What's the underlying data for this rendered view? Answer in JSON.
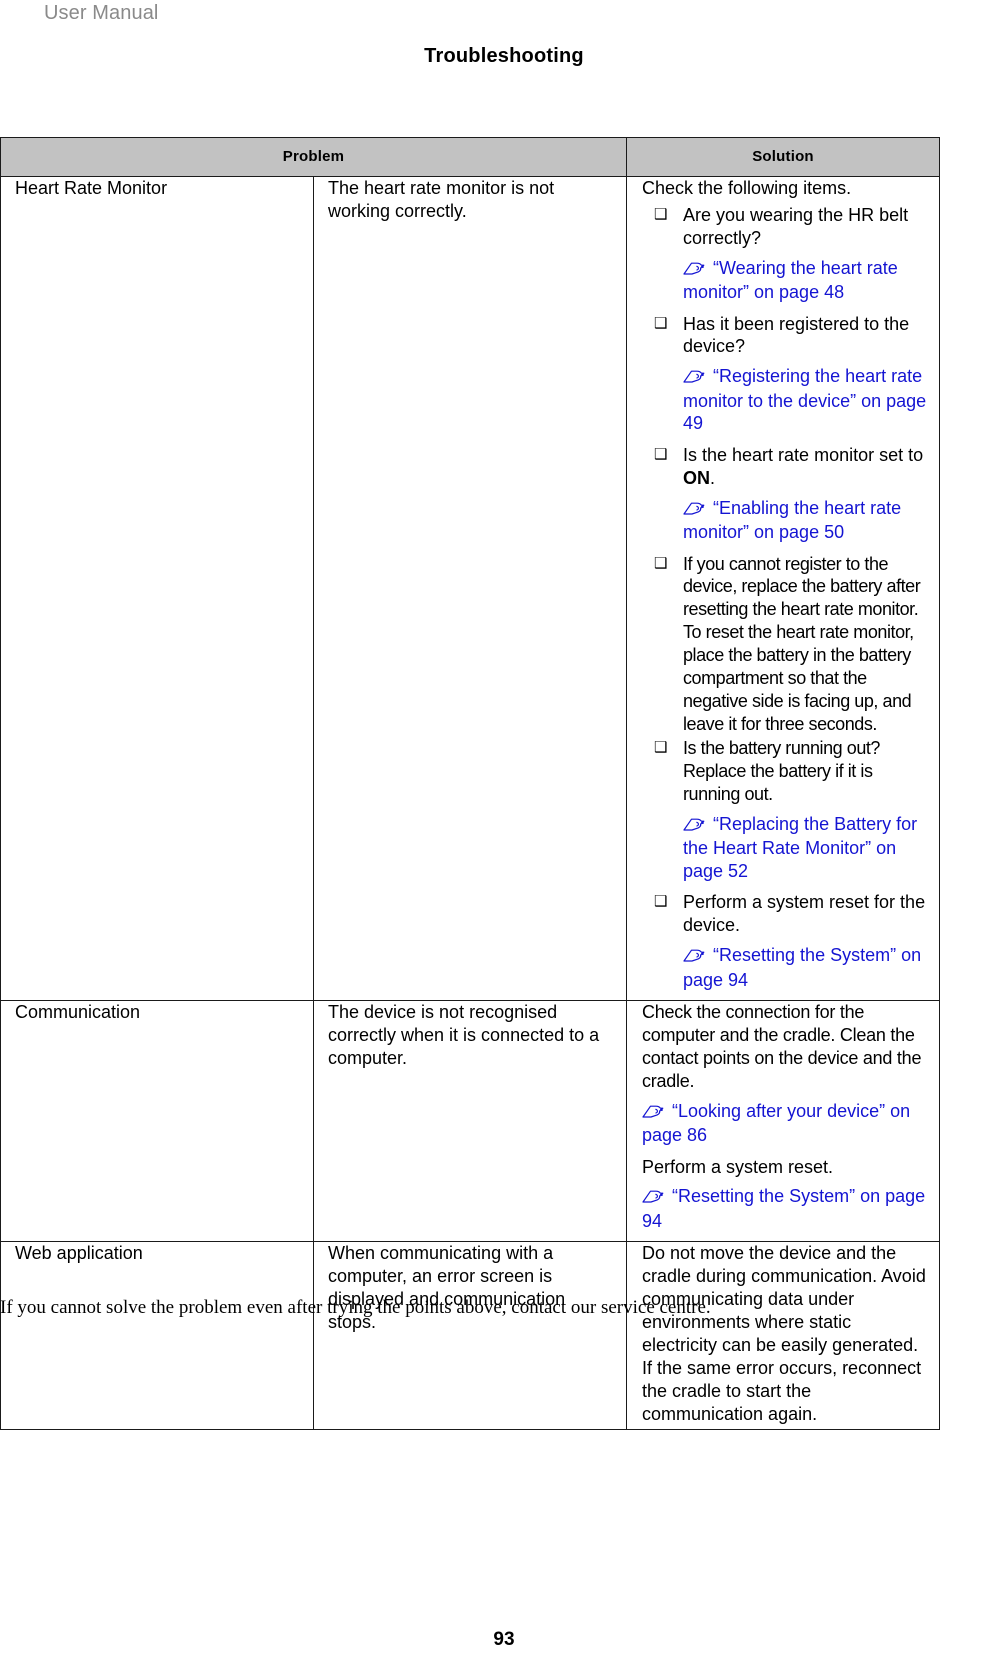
{
  "header": {
    "running_head": "User Manual",
    "chapter_title": "Troubleshooting"
  },
  "table": {
    "columns": [
      {
        "label": "Problem"
      },
      {
        "label": "Solution"
      }
    ],
    "rows": [
      {
        "category": "Heart Rate Monitor",
        "problem": "The heart rate monitor is not working correctly.",
        "solution_intro": "Check the following items.",
        "bullets": [
          {
            "text": "Are you wearing the HR belt correctly?",
            "xref": "“Wearing the heart rate monitor” on page 48"
          },
          {
            "text": "Has it been registered to the device?",
            "xref": "“Registering the heart rate monitor to the device” on page 49"
          },
          {
            "text_pre": "Is the heart rate monitor set to ",
            "text_bold": "ON",
            "text_post": ".",
            "xref": "“Enabling the heart rate monitor” on page 50"
          },
          {
            "text": "If you cannot register to the device, replace the battery after resetting the heart rate monitor. To reset the heart rate monitor, place the battery in the battery compartment so that the negative side is facing up, and leave it for three seconds.",
            "xref": ""
          },
          {
            "text": "Is the battery running out? Replace the battery if it is running out.",
            "xref": "“Replacing the Battery for the Heart Rate Monitor” on page 52"
          },
          {
            "text": "Perform a system reset for the device.",
            "xref": "“Resetting the System” on page 94"
          }
        ]
      },
      {
        "category": "Communication",
        "problem": "The device is not recognised correctly when it is connected to a computer.",
        "solution_blocks": [
          {
            "kind": "para",
            "text": "Check the connection for the computer and the cradle. Clean the contact points on the device and the cradle."
          },
          {
            "kind": "xref",
            "text": "“Looking after your device” on page 86"
          },
          {
            "kind": "para",
            "text": "Perform a system reset."
          },
          {
            "kind": "xref",
            "text": "“Resetting the System” on page 94"
          }
        ]
      },
      {
        "category": "Web application",
        "problem": "When communicating with a computer, an error screen is displayed and communication stops.",
        "solution_blocks": [
          {
            "kind": "para",
            "text": "Do not move the device and the cradle during communication. Avoid communicating data under environments where static electricity can be easily generated. If the same error occurs, reconnect the cradle to start the communication again."
          }
        ]
      }
    ]
  },
  "closing_note": "If you cannot solve the problem even after trying the points above, contact our service centre.",
  "page_number": "93",
  "icons": {
    "bullet": "❑",
    "xref_hand": "pointing-hand-icon"
  },
  "colors": {
    "link": "#1414d2",
    "header_fill": "#c2c2c2",
    "running_head": "#8a8a8a"
  }
}
